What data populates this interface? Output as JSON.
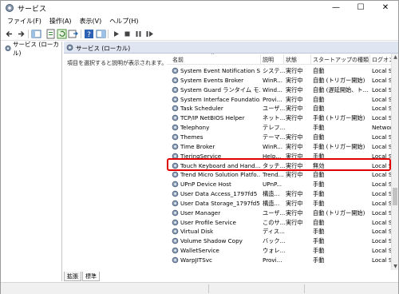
{
  "window": {
    "title": "サービス",
    "controls": {
      "minimize": "—",
      "maximize": "☐",
      "close": "✕"
    }
  },
  "menu": [
    "ファイル(F)",
    "操作(A)",
    "表示(V)",
    "ヘルプ(H)"
  ],
  "tree": {
    "root": "サービス (ローカル)"
  },
  "pane": {
    "header": "サービス (ローカル)",
    "description_prompt": "項目を選択すると説明が表示されます。"
  },
  "columns": {
    "name": "名前",
    "desc": "説明",
    "status": "状態",
    "startup": "スタートアップの種類",
    "logon": "ログオン"
  },
  "rows": [
    {
      "name": "System Event Notification S...",
      "desc": "システ...",
      "status": "実行中",
      "startup": "自動",
      "logon": "Local S"
    },
    {
      "name": "System Events Broker",
      "desc": "WinR...",
      "status": "実行中",
      "startup": "自動 (トリガー開始)",
      "logon": "Local S"
    },
    {
      "name": "System Guard ランタイム モニ...",
      "desc": "Wind...",
      "status": "実行中",
      "startup": "自動 (遅延開始、ト...",
      "logon": "Local S"
    },
    {
      "name": "System Interface Foundatio...",
      "desc": "Provi...",
      "status": "実行中",
      "startup": "自動",
      "logon": "Local S"
    },
    {
      "name": "Task Scheduler",
      "desc": "ユーザ...",
      "status": "実行中",
      "startup": "自動",
      "logon": "Local S"
    },
    {
      "name": "TCP/IP NetBIOS Helper",
      "desc": "ネット...",
      "status": "実行中",
      "startup": "手動 (トリガー開始)",
      "logon": "Local S"
    },
    {
      "name": "Telephony",
      "desc": "テレフ...",
      "status": "",
      "startup": "手動",
      "logon": "Networ"
    },
    {
      "name": "Themes",
      "desc": "テーマ...",
      "status": "実行中",
      "startup": "自動",
      "logon": "Local S"
    },
    {
      "name": "Time Broker",
      "desc": "WinR...",
      "status": "実行中",
      "startup": "手動 (トリガー開始)",
      "logon": "Local S"
    },
    {
      "name": "TieringService",
      "desc": "Help...",
      "status": "実行中",
      "startup": "手動",
      "logon": "Local S"
    },
    {
      "name": "Touch Keyboard and Hand...",
      "desc": "タッチ...",
      "status": "実行中",
      "startup": "無効",
      "logon": "Local S"
    },
    {
      "name": "Trend Micro Solution Platfo...",
      "desc": "Trend...",
      "status": "実行中",
      "startup": "自動",
      "logon": "Local S"
    },
    {
      "name": "UPnP Device Host",
      "desc": "UPnP...",
      "status": "",
      "startup": "手動",
      "logon": "Local S"
    },
    {
      "name": "User Data Access_1797fd5",
      "desc": "構造...",
      "status": "実行中",
      "startup": "手動",
      "logon": "Local S"
    },
    {
      "name": "User Data Storage_1797fd5",
      "desc": "構造...",
      "status": "実行中",
      "startup": "手動",
      "logon": "Local S"
    },
    {
      "name": "User Manager",
      "desc": "ユーザ...",
      "status": "実行中",
      "startup": "自動 (トリガー開始)",
      "logon": "Local S"
    },
    {
      "name": "User Profile Service",
      "desc": "このサ...",
      "status": "実行中",
      "startup": "自動",
      "logon": "Local S"
    },
    {
      "name": "Virtual Disk",
      "desc": "ディス...",
      "status": "",
      "startup": "手動",
      "logon": "Local S"
    },
    {
      "name": "Volume Shadow Copy",
      "desc": "バック...",
      "status": "",
      "startup": "手動",
      "logon": "Local S"
    },
    {
      "name": "WalletService",
      "desc": "ウォレ...",
      "status": "",
      "startup": "手動",
      "logon": "Local S"
    },
    {
      "name": "WarpJITSvc",
      "desc": "Provi...",
      "status": "",
      "startup": "手動",
      "logon": "Local S"
    }
  ],
  "tabs": [
    "拡張",
    "標準"
  ],
  "colors": {
    "highlight": "#e00000",
    "pane_header": "#dfe6f2"
  },
  "icons": [
    "services-icon",
    "back-icon",
    "forward-icon",
    "console-tree-icon",
    "properties-icon",
    "refresh-icon",
    "export-icon",
    "help-icon",
    "view-icon",
    "start-icon",
    "stop-icon",
    "pause-icon",
    "restart-icon",
    "gear-icon"
  ]
}
